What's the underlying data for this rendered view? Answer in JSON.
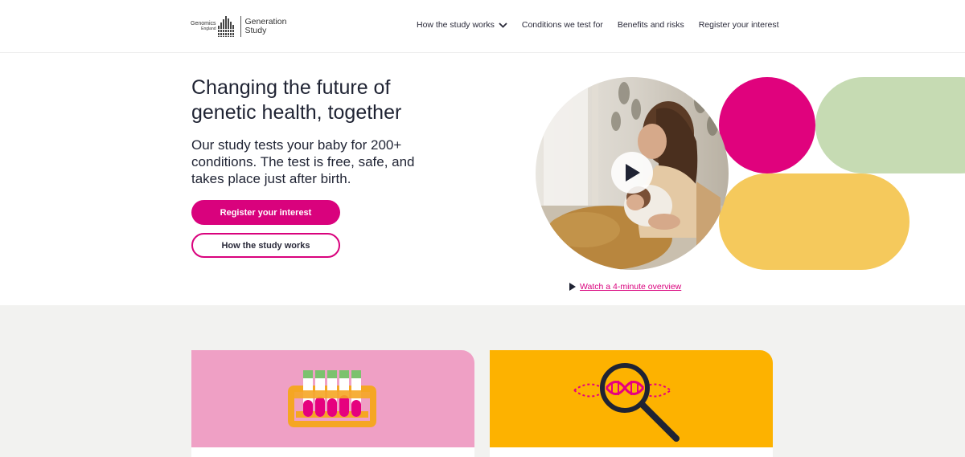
{
  "header": {
    "logo": {
      "org_line1": "Genomics",
      "org_line2": "England",
      "brand_line1": "Generation",
      "brand_line2": "Study"
    },
    "nav": [
      {
        "label": "How the study works",
        "has_dropdown": true,
        "icon": "chevron-down-icon"
      },
      {
        "label": "Conditions we test for"
      },
      {
        "label": "Benefits and risks"
      },
      {
        "label": "Register your interest"
      }
    ]
  },
  "hero": {
    "title": "Changing the future of genetic health, together",
    "subtitle": "Our study tests your baby for 200+ conditions. The test is free, safe, and takes place just after birth.",
    "primary_button": "Register your interest",
    "secondary_button": "How the study works",
    "video_link": "Watch a 4-minute overview",
    "play_icon": "play-icon"
  },
  "cards": [
    {
      "illustration": "test-tubes-icon",
      "color": "#efa0c5"
    },
    {
      "illustration": "dna-magnifier-icon",
      "color": "#fdb200"
    }
  ],
  "colors": {
    "accent": "#d9027d",
    "shape_magenta": "#e0027d",
    "shape_green": "#c6dbb3",
    "shape_yellow": "#f5c95c",
    "section_bg": "#f2f2f0"
  }
}
